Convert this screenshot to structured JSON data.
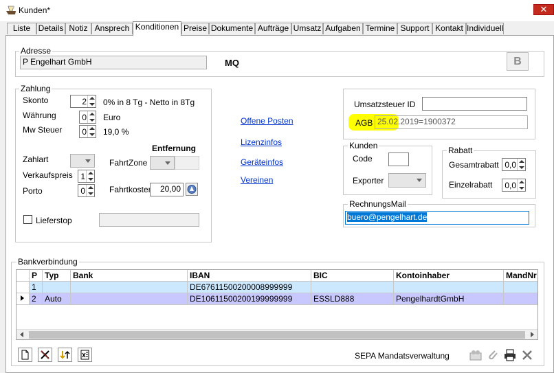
{
  "window": {
    "title": "Kunden*",
    "close_label": "✕"
  },
  "tabs": [
    "Liste",
    "Details",
    "Notiz",
    "Ansprech",
    "Konditionen",
    "Preise",
    "Dokumente",
    "Aufträge",
    "Umsatz",
    "Aufgaben",
    "Termine",
    "Support",
    "Kontakt",
    "Individuell"
  ],
  "active_tab": "Konditionen",
  "adresse": {
    "legend": "Adresse",
    "name": "P Engelhart GmbH",
    "code": "MQ",
    "b_button": "B"
  },
  "zahlung": {
    "legend": "Zahlung",
    "skonto_label": "Skonto",
    "skonto_value": "2",
    "skonto_text": "0% in 8 Tg - Netto in 8Tg",
    "waehrung_label": "Währung",
    "waehrung_value": "0",
    "waehrung_text": "Euro",
    "mwst_label": "Mw Steuer",
    "mwst_value": "0",
    "mwst_text": "19,0 %",
    "zahlart_label": "Zahlart",
    "verkaufspreis_label": "Verkaufspreis",
    "verkaufspreis_value": "1",
    "porto_label": "Porto",
    "porto_value": "0",
    "entfernung_label": "Entfernung",
    "fahrtzone_label": "FahrtZone",
    "fahrtkosten_label": "Fahrtkosten",
    "fahrtkosten_value": "20,00",
    "lieferstop_label": "Lieferstop"
  },
  "links": [
    "Offene Posten",
    "Lizenzinfos",
    "Geräteinfos",
    "Vereinen"
  ],
  "steuer": {
    "ust_label": "Umsatzsteuer ID",
    "ust_value": "",
    "agb_label": "AGB",
    "agb_value": "25.02.2019=1900372"
  },
  "kunden": {
    "legend": "Kunden",
    "code_label": "Code",
    "exporter_label": "Exporter"
  },
  "rabatt": {
    "legend": "Rabatt",
    "gesamt_label": "Gesamtrabatt",
    "gesamt_value": "0,0",
    "einzel_label": "Einzelrabatt",
    "einzel_value": "0,0"
  },
  "rechnungsmail": {
    "legend": "RechnungsMail",
    "value": "buero@pengelhart.de"
  },
  "bank": {
    "legend": "Bankverbindung",
    "columns": [
      "P",
      "Typ",
      "Bank",
      "IBAN",
      "BIC",
      "Kontoinhaber",
      "MandNr"
    ],
    "rows": [
      [
        "1",
        "",
        "",
        "DE67611500200008999999",
        "",
        "",
        ""
      ],
      [
        "2",
        "Auto",
        "",
        "DE10611500200199999999",
        "ESSLD888",
        "PengelhardtGmbH",
        ""
      ]
    ]
  },
  "footer": {
    "sepa_label": "SEPA Mandatsverwaltung"
  },
  "colors": {
    "selection": "#cce8ff",
    "row_highlight": "#c8c8ff",
    "highlight": "#ffff00"
  }
}
